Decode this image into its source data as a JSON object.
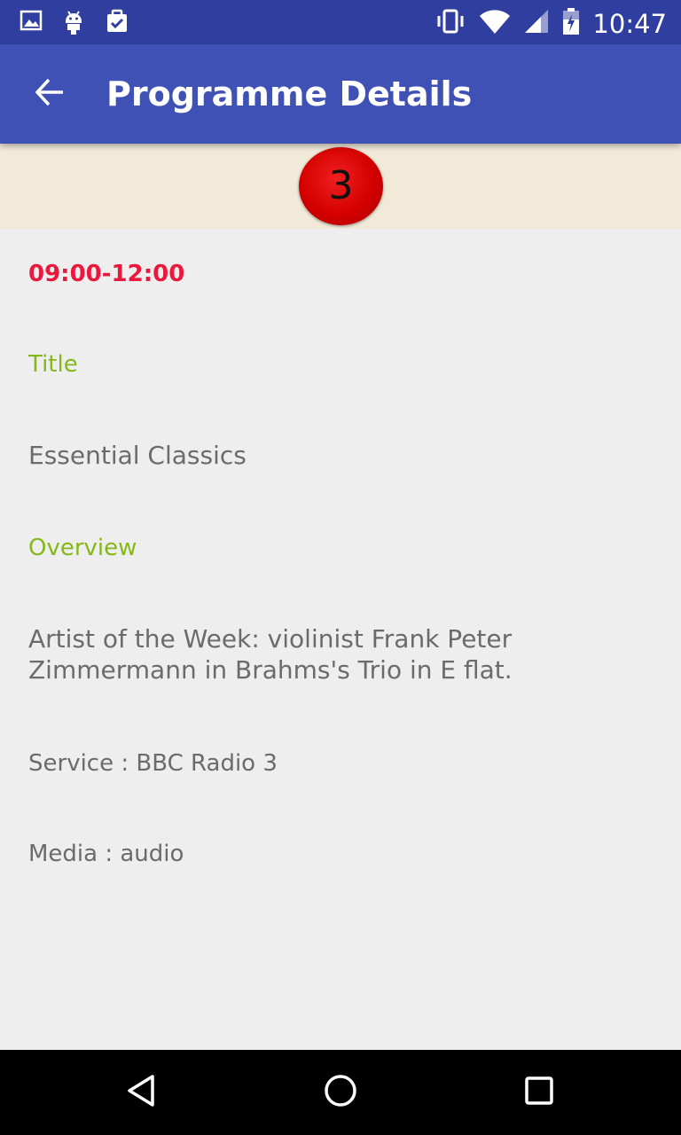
{
  "status_bar": {
    "time": "10:47",
    "left_icons": [
      "image-icon",
      "android-icon",
      "clipboard-check-icon"
    ],
    "right_icons": [
      "vibrate-icon",
      "wifi-icon",
      "signal-icon",
      "battery-icon"
    ]
  },
  "app_bar": {
    "title": "Programme Details",
    "back_icon": "arrow-left-icon"
  },
  "channel": {
    "number": "3",
    "logo_color": "#d40000",
    "strip_color": "#f1ead9"
  },
  "programme": {
    "time_range": "09:00-12:00",
    "title_label": "Title",
    "title": "Essential Classics",
    "overview_label": "Overview",
    "overview": "Artist of the Week: violinist Frank Peter Zimmermann in Brahms's Trio in E flat.",
    "service": "Service : BBC Radio 3",
    "media": "Media : audio"
  },
  "colors": {
    "primary": "#3f51b5",
    "primary_dark": "#303f9f",
    "time_accent": "#e8193c",
    "label_accent": "#86b81a"
  },
  "nav_bar": {
    "icons": [
      "back-triangle-icon",
      "home-circle-icon",
      "recents-square-icon"
    ]
  }
}
